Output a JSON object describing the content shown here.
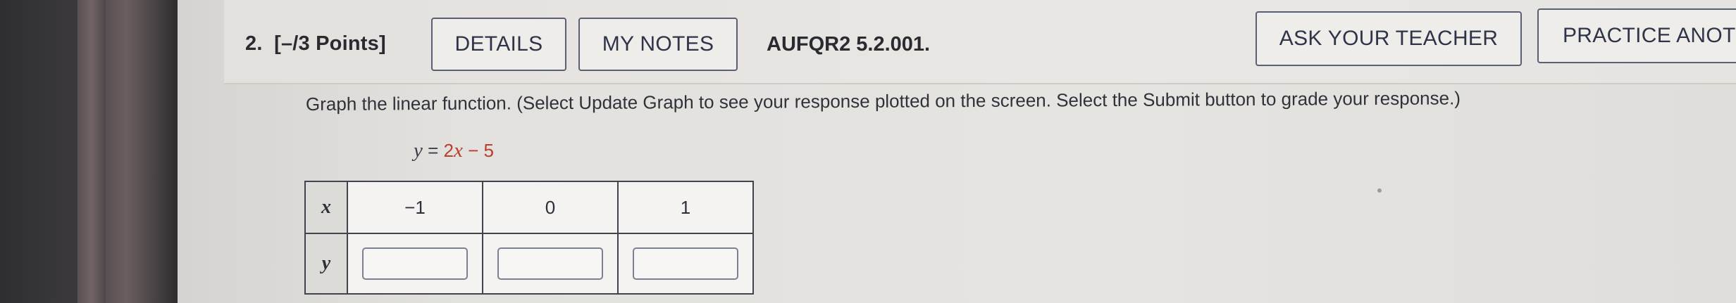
{
  "question": {
    "number_label": "2.",
    "points_label": "[–/3 Points]",
    "problem_id": "AUFQR2 5.2.001."
  },
  "toolbar": {
    "details_label": "DETAILS",
    "my_notes_label": "MY NOTES",
    "ask_teacher_label": "ASK YOUR TEACHER",
    "practice_label": "PRACTICE ANOT"
  },
  "body": {
    "instructions": "Graph the linear function. (Select Update Graph to see your response plotted on the screen. Select the Submit button to grade your response.)",
    "equation": {
      "lhs_var": "y",
      "equals": " = ",
      "coefficient": "2",
      "rhs_var": "x",
      "rest": " − 5"
    }
  },
  "table": {
    "x_header": "x",
    "y_header": "y",
    "x_values": [
      "−1",
      "0",
      "1"
    ],
    "y_values": [
      "",
      "",
      ""
    ]
  }
}
